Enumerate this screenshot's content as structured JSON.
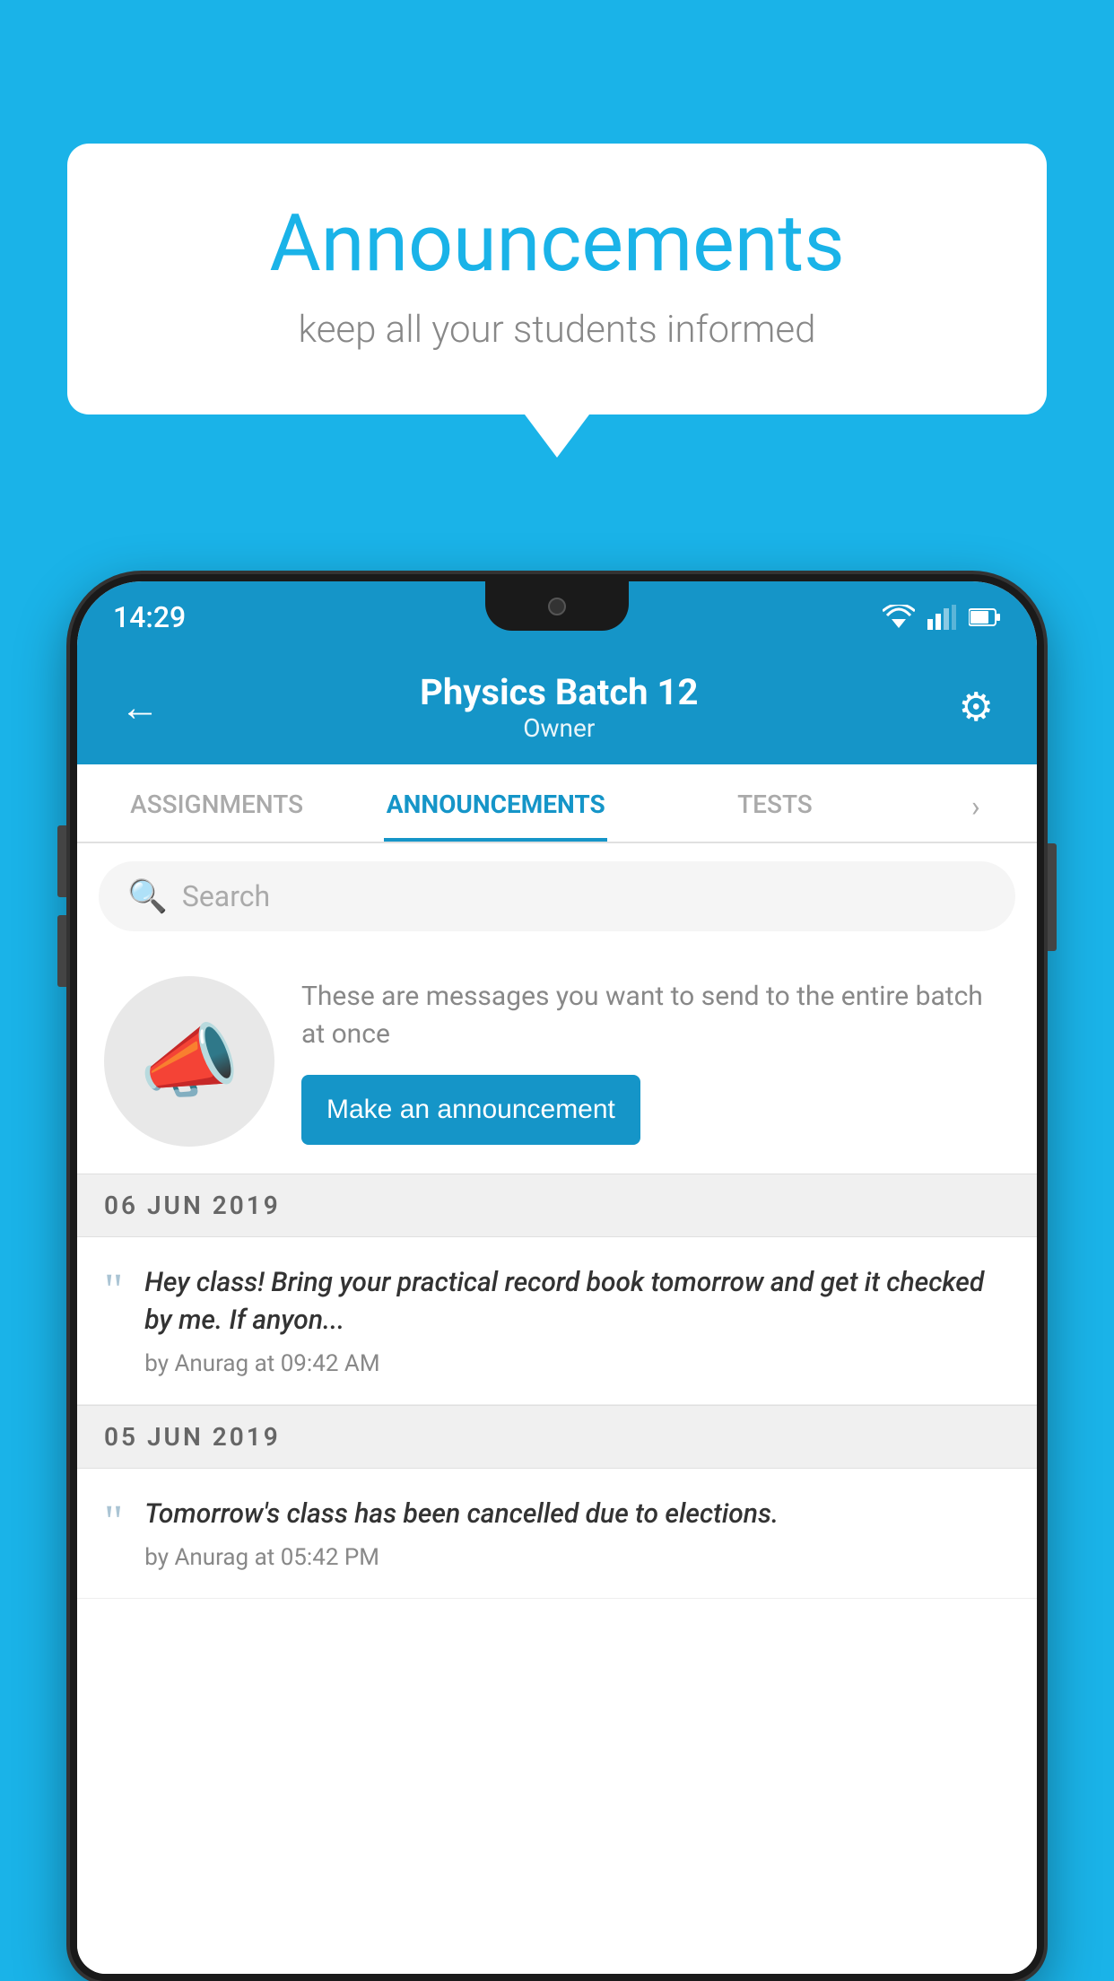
{
  "background_color": "#1ab3e8",
  "speech_bubble": {
    "title": "Announcements",
    "subtitle": "keep all your students informed"
  },
  "status_bar": {
    "time": "14:29"
  },
  "app_header": {
    "batch_name": "Physics Batch 12",
    "role": "Owner",
    "back_label": "←",
    "gear_label": "⚙"
  },
  "tabs": [
    {
      "label": "ASSIGNMENTS",
      "active": false
    },
    {
      "label": "ANNOUNCEMENTS",
      "active": true
    },
    {
      "label": "TESTS",
      "active": false
    },
    {
      "label": "›",
      "active": false
    }
  ],
  "search": {
    "placeholder": "Search"
  },
  "announcement_prompt": {
    "description": "These are messages you want to send to the entire batch at once",
    "button_label": "Make an announcement"
  },
  "dates": [
    {
      "label": "06  JUN  2019",
      "announcements": [
        {
          "text": "Hey class! Bring your practical record book tomorrow and get it checked by me. If anyon...",
          "by": "by Anurag at 09:42 AM"
        }
      ]
    },
    {
      "label": "05  JUN  2019",
      "announcements": [
        {
          "text": "Tomorrow's class has been cancelled due to elections.",
          "by": "by Anurag at 05:42 PM"
        }
      ]
    }
  ]
}
